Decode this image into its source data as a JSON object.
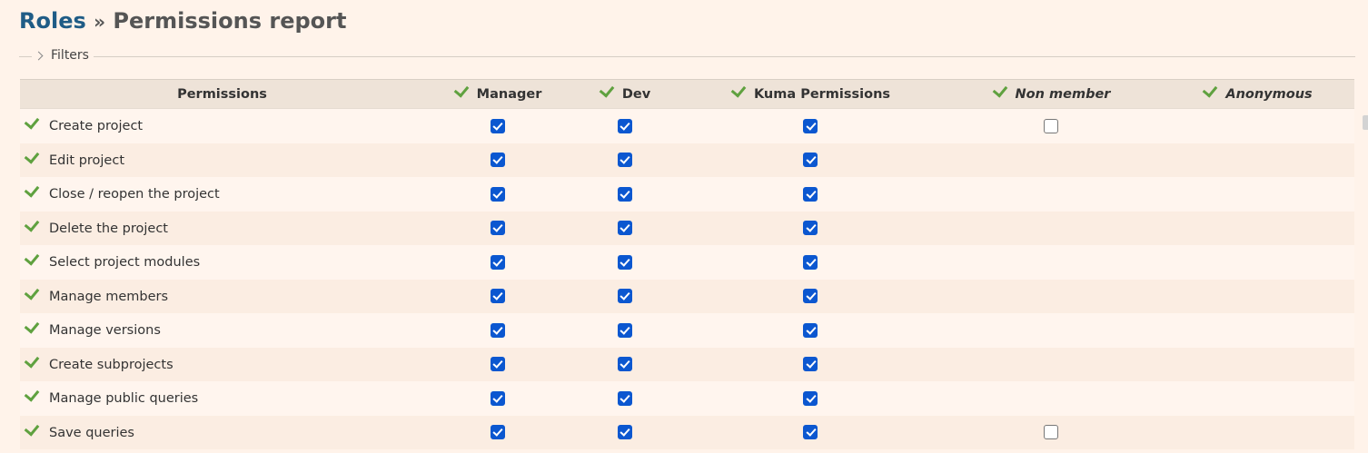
{
  "breadcrumb": {
    "parent": "Roles",
    "separator": "»",
    "current": "Permissions report"
  },
  "filters": {
    "label": "Filters"
  },
  "table": {
    "header_permissions": "Permissions",
    "roles": [
      {
        "name": "Manager",
        "italic": false
      },
      {
        "name": "Dev",
        "italic": false
      },
      {
        "name": "Kuma Permissions",
        "italic": false
      },
      {
        "name": "Non member",
        "italic": true
      },
      {
        "name": "Anonymous",
        "italic": true
      }
    ],
    "rows": [
      {
        "label": "Create project",
        "checks": [
          true,
          true,
          true,
          false,
          null
        ]
      },
      {
        "label": "Edit project",
        "checks": [
          true,
          true,
          true,
          null,
          null
        ]
      },
      {
        "label": "Close / reopen the project",
        "checks": [
          true,
          true,
          true,
          null,
          null
        ]
      },
      {
        "label": "Delete the project",
        "checks": [
          true,
          true,
          true,
          null,
          null
        ]
      },
      {
        "label": "Select project modules",
        "checks": [
          true,
          true,
          true,
          null,
          null
        ]
      },
      {
        "label": "Manage members",
        "checks": [
          true,
          true,
          true,
          null,
          null
        ]
      },
      {
        "label": "Manage versions",
        "checks": [
          true,
          true,
          true,
          null,
          null
        ]
      },
      {
        "label": "Create subprojects",
        "checks": [
          true,
          true,
          true,
          null,
          null
        ]
      },
      {
        "label": "Manage public queries",
        "checks": [
          true,
          true,
          true,
          null,
          null
        ]
      },
      {
        "label": "Save queries",
        "checks": [
          true,
          true,
          true,
          false,
          null
        ]
      }
    ]
  },
  "icons": {
    "toggle": "check-mark-icon",
    "filters_toggle": "chevron-right-icon"
  },
  "colors": {
    "link": "#1f5c86",
    "tick": "#5fa13f",
    "checkbox_checked": "#0b57d0",
    "background": "#fff3ea"
  }
}
